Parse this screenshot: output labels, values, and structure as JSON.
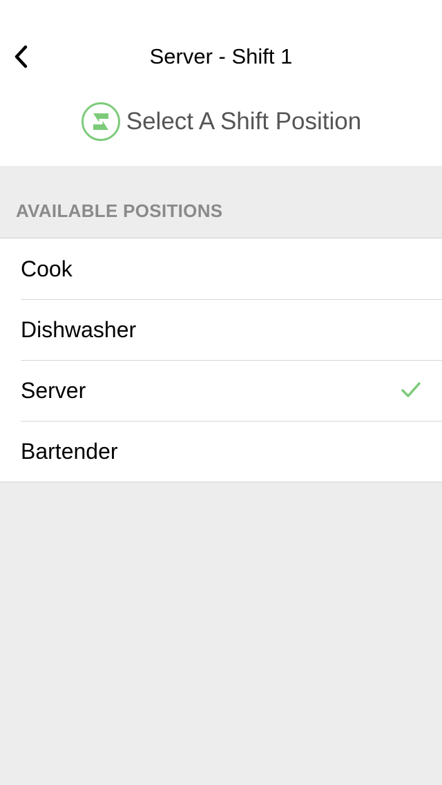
{
  "nav": {
    "back_icon": "chevron-left-icon",
    "title": "Server - Shift 1"
  },
  "header": {
    "logo_icon": "shift-logo-icon",
    "title": "Select A Shift Position",
    "accent_color": "#7dcb7a"
  },
  "section": {
    "label": "AVAILABLE POSITIONS"
  },
  "positions": [
    {
      "label": "Cook",
      "selected": false
    },
    {
      "label": "Dishwasher",
      "selected": false
    },
    {
      "label": "Server",
      "selected": true
    },
    {
      "label": "Bartender",
      "selected": false
    }
  ],
  "selected_icon": "checkmark-icon"
}
